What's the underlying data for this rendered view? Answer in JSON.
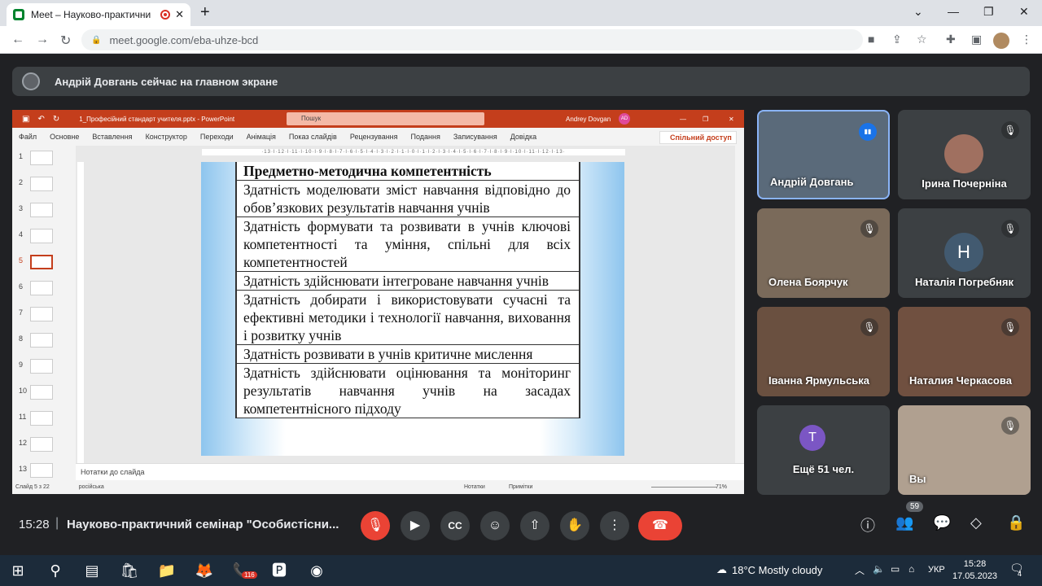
{
  "browser": {
    "tab_title": "Meet – Науково-практични",
    "url": "meet.google.com/eba-uhze-bcd",
    "new_tab": "+"
  },
  "meet": {
    "banner": "Андрій Довгань сейчас на главном экране",
    "time": "15:28",
    "separator": "|",
    "meeting_title": "Науково-практичний семінар \"Особистісни...",
    "participants_badge": "59",
    "participants": [
      {
        "name": "Андрій Довгань",
        "color": "#5a6a7a"
      },
      {
        "name": "Ірина Почерніна",
        "color": "#3c4043"
      },
      {
        "name": "Олена Боярчук",
        "color": "#7a6a5a"
      },
      {
        "name": "Наталія Погребняк",
        "color": "#3c4043",
        "initial": "Н"
      },
      {
        "name": "Іванна Ярмульська",
        "color": "#6a5040"
      },
      {
        "name": "Наталия Черкасова",
        "color": "#705040"
      },
      {
        "name": "Ещё 51 чел.",
        "color": "#3c4043",
        "initial": "Т"
      },
      {
        "name": "Вы",
        "color": "#b0a090"
      }
    ]
  },
  "ppt": {
    "file": "1_Професійний стандарт учителя.pptx - PowerPoint",
    "search": "Пошук",
    "user": "Andrey Dovgan",
    "user_initials": "AD",
    "menu": [
      "Файл",
      "Основне",
      "Вставлення",
      "Конструктор",
      "Переходи",
      "Анімація",
      "Показ слайдів",
      "Рецензування",
      "Подання",
      "Записування",
      "Довідка"
    ],
    "share": "Спільний доступ",
    "thumbs": [
      "1",
      "2",
      "3",
      "4",
      "5",
      "6",
      "7",
      "8",
      "9",
      "10",
      "11",
      "12",
      "13"
    ],
    "ruler": "·13·l·12·l·11·l·10·l·9·l·8·l·7·l·6·l·5·l·4·l·3·l·2·l·1·l·0·l·1·l·2·l·3·l·4·l·5·l·6·l·7·l·8·l·9·l·10·l·11·l·12·l·13·",
    "slide_rows": [
      "Предметно-методична компетентність",
      "Здатність моделювати зміст навчання відповідно до обов’язкових результатів навчання учнів",
      "Здатність формувати та розвивати в учнів ключові компетентності та уміння, спільні для всіх компетентностей",
      "Здатність здійснювати інтегроване навчання учнів",
      "Здатність добирати і використовувати сучасні та ефективні методики і технології навчання, виховання і розвитку учнів",
      "Здатність розвивати в учнів критичне мислення",
      "Здатність здійснювати оцінювання та моніторинг результатів навчання учнів на засадах компетентнісного підходу"
    ],
    "notes_placeholder": "Нотатки до слайда",
    "status_slide": "Слайд 5 з 22",
    "status_lang": "російська",
    "status_notes": "Нотатки",
    "status_comments": "Примітки",
    "zoom": "71%"
  },
  "taskbar": {
    "weather": "18°C  Mostly cloudy",
    "lang": "УКР",
    "time": "15:28",
    "date": "17.05.2023",
    "viber_badge": "116",
    "notif": "4"
  }
}
